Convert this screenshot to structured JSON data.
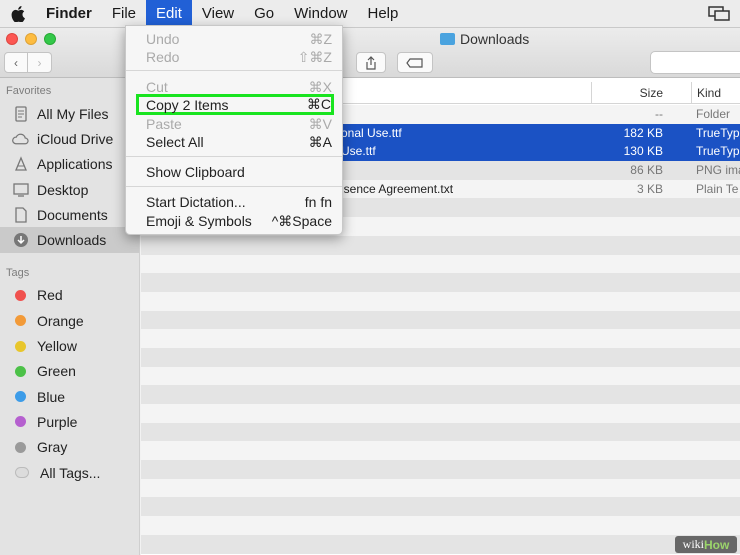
{
  "menubar": {
    "items": [
      {
        "label": "Finder",
        "bold": true
      },
      {
        "label": "File"
      },
      {
        "label": "Edit",
        "active": true
      },
      {
        "label": "View"
      },
      {
        "label": "Go"
      },
      {
        "label": "Window"
      },
      {
        "label": "Help"
      }
    ]
  },
  "window": {
    "title": "Downloads",
    "search_placeholder": ""
  },
  "sidebar": {
    "favorites_label": "Favorites",
    "favorites": [
      {
        "label": "All My Files",
        "icon": "all-files-icon"
      },
      {
        "label": "iCloud Drive",
        "icon": "cloud-icon"
      },
      {
        "label": "Applications",
        "icon": "applications-icon"
      },
      {
        "label": "Desktop",
        "icon": "desktop-icon"
      },
      {
        "label": "Documents",
        "icon": "documents-icon"
      },
      {
        "label": "Downloads",
        "icon": "downloads-icon",
        "selected": true
      }
    ],
    "tags_label": "Tags",
    "tags": [
      {
        "label": "Red",
        "color": "#f0514e"
      },
      {
        "label": "Orange",
        "color": "#f29a38"
      },
      {
        "label": "Yellow",
        "color": "#e8c62c"
      },
      {
        "label": "Green",
        "color": "#4cc148"
      },
      {
        "label": "Blue",
        "color": "#3d9ce8"
      },
      {
        "label": "Purple",
        "color": "#b560cf"
      },
      {
        "label": "Gray",
        "color": "#9a9a9a"
      },
      {
        "label": "All Tags...",
        "color": "#dcdcdc"
      }
    ]
  },
  "list": {
    "columns": {
      "size": "Size",
      "kind": "Kind"
    },
    "rows": [
      {
        "name": "",
        "size": "--",
        "kind": "Folder",
        "highlight": false
      },
      {
        "name": "onal Use.ttf",
        "size": "182 KB",
        "kind": "TrueTyp",
        "highlight": true
      },
      {
        "name": "Use.ttf",
        "size": "130 KB",
        "kind": "TrueTyp",
        "highlight": true
      },
      {
        "name": "",
        "size": "86 KB",
        "kind": "PNG ima",
        "highlight": false
      },
      {
        "name": "isence Agreement.txt",
        "size": "3 KB",
        "kind": "Plain Te",
        "highlight": false
      }
    ]
  },
  "edit_menu": {
    "items": [
      {
        "label": "Undo",
        "shortcut": "⌘Z",
        "disabled": true
      },
      {
        "label": "Redo",
        "shortcut": "⇧⌘Z",
        "disabled": true
      },
      {
        "label": "Cut",
        "shortcut": "⌘X",
        "disabled": true
      },
      {
        "label": "Copy 2 Items",
        "shortcut": "⌘C",
        "disabled": false,
        "highlight": true
      },
      {
        "label": "Paste",
        "shortcut": "⌘V",
        "disabled": true
      },
      {
        "label": "Select All",
        "shortcut": "⌘A",
        "disabled": false
      },
      {
        "label": "Show Clipboard",
        "shortcut": "",
        "disabled": false
      },
      {
        "label": "Start Dictation...",
        "shortcut": "fn fn",
        "disabled": false
      },
      {
        "label": "Emoji & Symbols",
        "shortcut": "^⌘Space",
        "disabled": false
      }
    ]
  },
  "watermark": {
    "prefix": "wiki",
    "suffix": "How"
  },
  "colors": {
    "accent": "#2160d6",
    "highlight_box": "#19e41f",
    "selection": "#1b52c4"
  }
}
